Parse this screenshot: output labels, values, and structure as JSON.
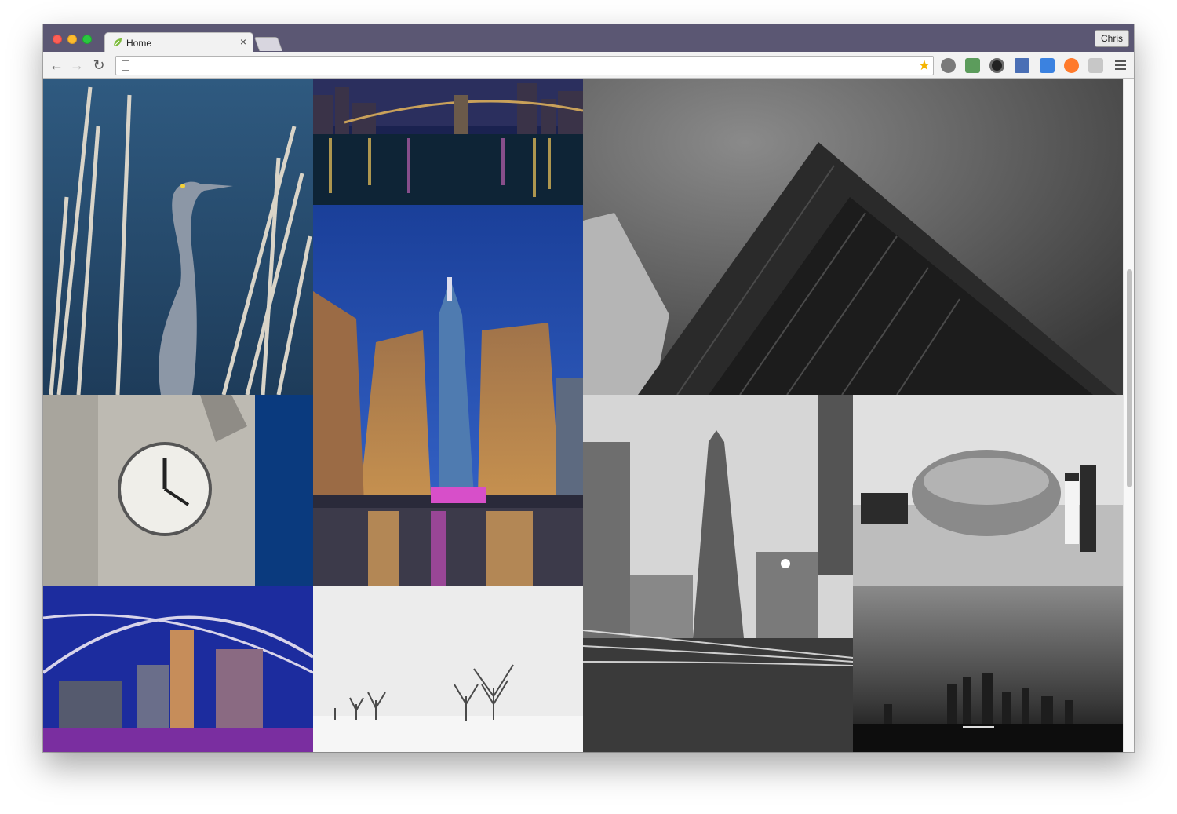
{
  "browser": {
    "tab_title": "Home",
    "tab_close": "×",
    "profile_name": "Chris",
    "nav": {
      "back": "←",
      "forward": "→",
      "reload": "↻"
    },
    "address": "",
    "bookmark_star": "★",
    "extensions": [
      {
        "name": "sync-icon",
        "color": "#6d6d6d"
      },
      {
        "name": "js-extension-icon",
        "color": "#4e8e4e"
      },
      {
        "name": "lens-extension-icon",
        "color": "#222222"
      },
      {
        "name": "calendar-extension-icon",
        "color": "#4a6fb5"
      },
      {
        "name": "blue-extension-icon",
        "color": "#3b82e0"
      },
      {
        "name": "orange-extension-icon",
        "color": "#ff7a2b"
      },
      {
        "name": "chat-extension-icon",
        "color": "#c7c7c7"
      }
    ],
    "accent": "#5b5773"
  },
  "gallery": {
    "photos": [
      {
        "id": "heron",
        "subject": "heron-photo"
      },
      {
        "id": "brooklyn-bridge",
        "subject": "brooklyn-bridge-photo"
      },
      {
        "id": "skyscraper-bw",
        "subject": "skyscraper-bw-photo"
      },
      {
        "id": "world-trade-center",
        "subject": "world-trade-center-photo"
      },
      {
        "id": "clock-tower",
        "subject": "clock-tower-photo"
      },
      {
        "id": "flatiron",
        "subject": "flatiron-building-photo"
      },
      {
        "id": "bean-wedding",
        "subject": "cloud-gate-wedding-photo"
      },
      {
        "id": "pavilion-night",
        "subject": "pavilion-night-photo"
      },
      {
        "id": "snow-trees",
        "subject": "snow-trees-photo"
      },
      {
        "id": "skyline-bw",
        "subject": "skyline-bw-photo"
      }
    ]
  }
}
